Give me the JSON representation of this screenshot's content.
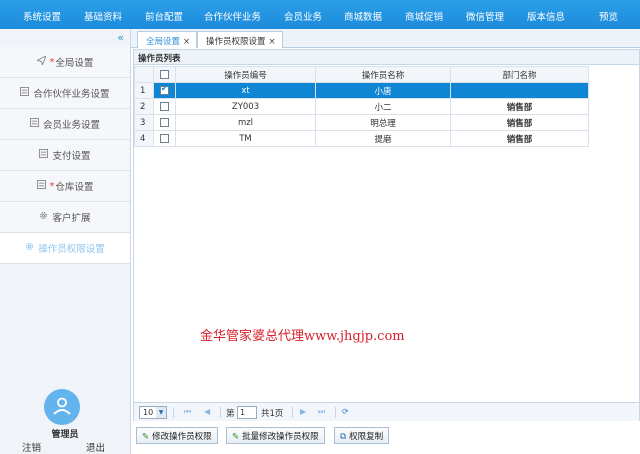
{
  "topnav": {
    "items": [
      "系统设置",
      "基础资料",
      "前台配置",
      "合作伙伴业务",
      "会员业务",
      "商城数据",
      "商城促销",
      "微信管理",
      "版本信息",
      "预览"
    ]
  },
  "sidebar": {
    "collapse_icon": "«",
    "items": [
      {
        "label": "全局设置",
        "required": true,
        "icon": "send-icon"
      },
      {
        "label": "合作伙伴业务设置",
        "required": false,
        "icon": "list-icon"
      },
      {
        "label": "会员业务设置",
        "required": false,
        "icon": "list-icon"
      },
      {
        "label": "支付设置",
        "required": false,
        "icon": "list-icon"
      },
      {
        "label": "仓库设置",
        "required": true,
        "icon": "list-icon"
      },
      {
        "label": "客户扩展",
        "required": false,
        "icon": "gear-icon"
      },
      {
        "label": "操作员权限设置",
        "required": false,
        "icon": "gear-icon",
        "active": true
      }
    ],
    "user_name": "管理员",
    "logout_label": "注销",
    "quit_label": "退出"
  },
  "tabs": [
    {
      "label": "全局设置",
      "close": "×"
    },
    {
      "label": "操作员权限设置",
      "close": "×"
    }
  ],
  "panel": {
    "title": "操作员列表",
    "columns": [
      "操作员编号",
      "操作员名称",
      "部门名称"
    ],
    "rows": [
      {
        "num": "1",
        "checked": true,
        "code": "xt",
        "name": "小唐",
        "dept": ""
      },
      {
        "num": "2",
        "checked": false,
        "code": "ZY003",
        "name": "小二",
        "dept": "销售部"
      },
      {
        "num": "3",
        "checked": false,
        "code": "mzl",
        "name": "明总理",
        "dept": "销售部"
      },
      {
        "num": "4",
        "checked": false,
        "code": "TM",
        "name": "提磨",
        "dept": "销售部"
      }
    ]
  },
  "watermark": "金华管家婆总代理www.jhgjp.com",
  "pager": {
    "page_size": "10",
    "page_prefix": "第",
    "page_value": "1",
    "page_total": "共1页"
  },
  "toolbar": {
    "edit_label": "修改操作员权限",
    "batch_edit_label": "批量修改操作员权限",
    "copy_label": "权限复制"
  },
  "colors": {
    "nav_bg": "#1d8bdb",
    "selected_row": "#0f86d4",
    "watermark": "#d81e2a",
    "required_star": "#ee3333"
  }
}
